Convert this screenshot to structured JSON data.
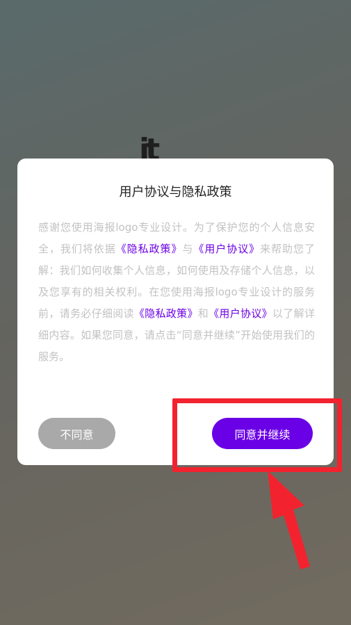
{
  "background": {
    "logo_fragment": "it"
  },
  "dialog": {
    "title": "用户协议与隐私政策",
    "body": {
      "p1": "感谢您使用海报logo专业设计。为了保护您的个人信息安全，我们将依据",
      "link_privacy": "《隐私政策》",
      "p2": "与",
      "link_user": "《用户协议》",
      "p3": "来帮助您了解：我们如何收集个人信息，如何使用及存储个人信息，以及您享有的相关权利。在您使用海报logo专业设计的服务前，请务必仔细阅读",
      "link_privacy_2": "《隐私政策》",
      "p4": "和",
      "link_user_2": "《用户协议》",
      "p5": "以了解详细内容。如果您同意，请点击“同意并继续”开始使用我们的服务。"
    },
    "disagree_label": "不同意",
    "agree_label": "同意并继续"
  },
  "colors": {
    "accent": "#6a00e6",
    "annotation": "#f2232e",
    "disagree_bg": "#a9a9a9"
  }
}
